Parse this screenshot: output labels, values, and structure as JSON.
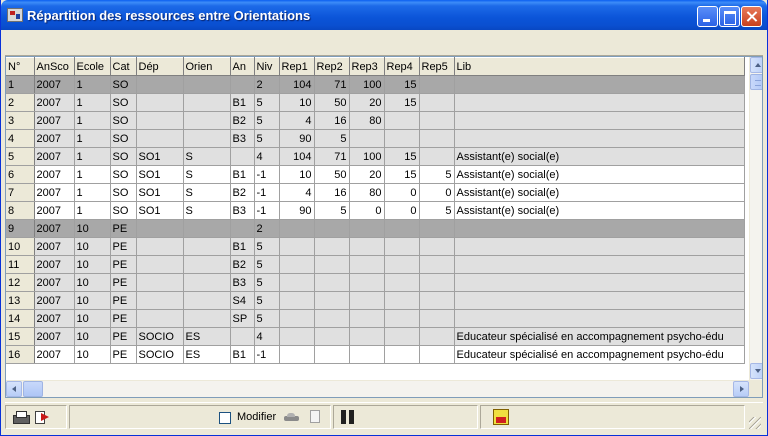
{
  "window": {
    "title": "Répartition des ressources entre Orientations"
  },
  "grid": {
    "columns": [
      "N°",
      "AnSco",
      "Ecole",
      "Cat",
      "Dép",
      "Orien",
      "An",
      "Niv",
      "Rep1",
      "Rep2",
      "Rep3",
      "Rep4",
      "Rep5",
      "Lib"
    ],
    "rows": [
      {
        "n": "1",
        "style": "dark",
        "cells": [
          "2007",
          "1",
          "SO",
          "",
          "",
          "",
          "2",
          "104",
          "71",
          "100",
          "15",
          "",
          ""
        ]
      },
      {
        "n": "2",
        "style": "light",
        "cells": [
          "2007",
          "1",
          "SO",
          "",
          "",
          "B1",
          "5",
          "10",
          "50",
          "20",
          "15",
          "",
          ""
        ]
      },
      {
        "n": "3",
        "style": "light",
        "cells": [
          "2007",
          "1",
          "SO",
          "",
          "",
          "B2",
          "5",
          "4",
          "16",
          "80",
          "",
          "",
          ""
        ]
      },
      {
        "n": "4",
        "style": "light",
        "cells": [
          "2007",
          "1",
          "SO",
          "",
          "",
          "B3",
          "5",
          "90",
          "5",
          "",
          "",
          "",
          ""
        ]
      },
      {
        "n": "5",
        "style": "light",
        "cells": [
          "2007",
          "1",
          "SO",
          "SO1",
          "S",
          "",
          "4",
          "104",
          "71",
          "100",
          "15",
          "",
          "Assistant(e) social(e)"
        ]
      },
      {
        "n": "6",
        "style": "white",
        "cells": [
          "2007",
          "1",
          "SO",
          "SO1",
          "S",
          "B1",
          "-1",
          "10",
          "50",
          "20",
          "15",
          "5",
          "Assistant(e) social(e)"
        ]
      },
      {
        "n": "7",
        "style": "white",
        "cells": [
          "2007",
          "1",
          "SO",
          "SO1",
          "S",
          "B2",
          "-1",
          "4",
          "16",
          "80",
          "0",
          "0",
          "Assistant(e) social(e)"
        ]
      },
      {
        "n": "8",
        "style": "white",
        "cells": [
          "2007",
          "1",
          "SO",
          "SO1",
          "S",
          "B3",
          "-1",
          "90",
          "5",
          "0",
          "0",
          "5",
          "Assistant(e) social(e)"
        ]
      },
      {
        "n": "9",
        "style": "dark",
        "cells": [
          "2007",
          "10",
          "PE",
          "",
          "",
          "",
          "2",
          "",
          "",
          "",
          "",
          "",
          ""
        ]
      },
      {
        "n": "10",
        "style": "light",
        "cells": [
          "2007",
          "10",
          "PE",
          "",
          "",
          "B1",
          "5",
          "",
          "",
          "",
          "",
          "",
          ""
        ]
      },
      {
        "n": "11",
        "style": "light",
        "cells": [
          "2007",
          "10",
          "PE",
          "",
          "",
          "B2",
          "5",
          "",
          "",
          "",
          "",
          "",
          ""
        ]
      },
      {
        "n": "12",
        "style": "light",
        "cells": [
          "2007",
          "10",
          "PE",
          "",
          "",
          "B3",
          "5",
          "",
          "",
          "",
          "",
          "",
          ""
        ]
      },
      {
        "n": "13",
        "style": "light",
        "cells": [
          "2007",
          "10",
          "PE",
          "",
          "",
          "S4",
          "5",
          "",
          "",
          "",
          "",
          "",
          ""
        ]
      },
      {
        "n": "14",
        "style": "light",
        "cells": [
          "2007",
          "10",
          "PE",
          "",
          "",
          "SP",
          "5",
          "",
          "",
          "",
          "",
          "",
          ""
        ]
      },
      {
        "n": "15",
        "style": "light",
        "cells": [
          "2007",
          "10",
          "PE",
          "SOCIO",
          "ES",
          "",
          "4",
          "",
          "",
          "",
          "",
          "",
          "Educateur spécialisé en accompagnement psycho-édu"
        ]
      },
      {
        "n": "16",
        "style": "white",
        "cells": [
          "2007",
          "10",
          "PE",
          "SOCIO",
          "ES",
          "B1",
          "-1",
          "",
          "",
          "",
          "",
          "",
          "Educateur spécialisé en accompagnement psycho-édu"
        ]
      }
    ]
  },
  "statusbar": {
    "modifier_label": "Modifier",
    "modifier_checked": false
  },
  "icons": {
    "app": "app-icon",
    "print": "printer-icon",
    "export": "export-icon",
    "car": "car-icon",
    "document": "doc-icon",
    "binoculars": "binoculars-icon",
    "report": "report-icon"
  },
  "colors": {
    "title_bar": "#0b54d8",
    "row_dark": "#a8a8a8",
    "row_light": "#e0e0e0",
    "row_white": "#ffffff"
  }
}
